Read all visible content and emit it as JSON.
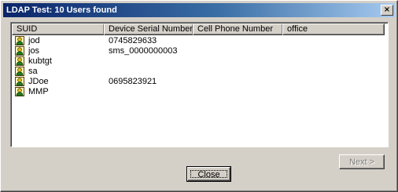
{
  "window": {
    "title": "LDAP Test: 10 Users found",
    "close_glyph": "×"
  },
  "list": {
    "columns": [
      "SUID",
      "Device Serial Number",
      "Cell Phone Number",
      "office"
    ],
    "rows": [
      {
        "suid": "jod",
        "serial": "0745829633",
        "cell": "",
        "office": "",
        "icon": "user-icon"
      },
      {
        "suid": "jos",
        "serial": "sms_0000000003",
        "cell": "",
        "office": "",
        "icon": "user-icon"
      },
      {
        "suid": "kubtgt",
        "serial": "",
        "cell": "",
        "office": "",
        "icon": "user-icon"
      },
      {
        "suid": "sa",
        "serial": "",
        "cell": "",
        "office": "",
        "icon": "user-icon"
      },
      {
        "suid": "JDoe",
        "serial": "0695823921",
        "cell": "",
        "office": "",
        "icon": "user-icon"
      },
      {
        "suid": "MMP",
        "serial": "",
        "cell": "",
        "office": "",
        "icon": "user-icon"
      }
    ]
  },
  "buttons": {
    "next_label": "Next >",
    "close_label": "Close"
  },
  "colors": {
    "title_start": "#0a246a",
    "title_end": "#a6caf0",
    "face": "#d4d0c8",
    "icon_face": "#e8c020"
  }
}
